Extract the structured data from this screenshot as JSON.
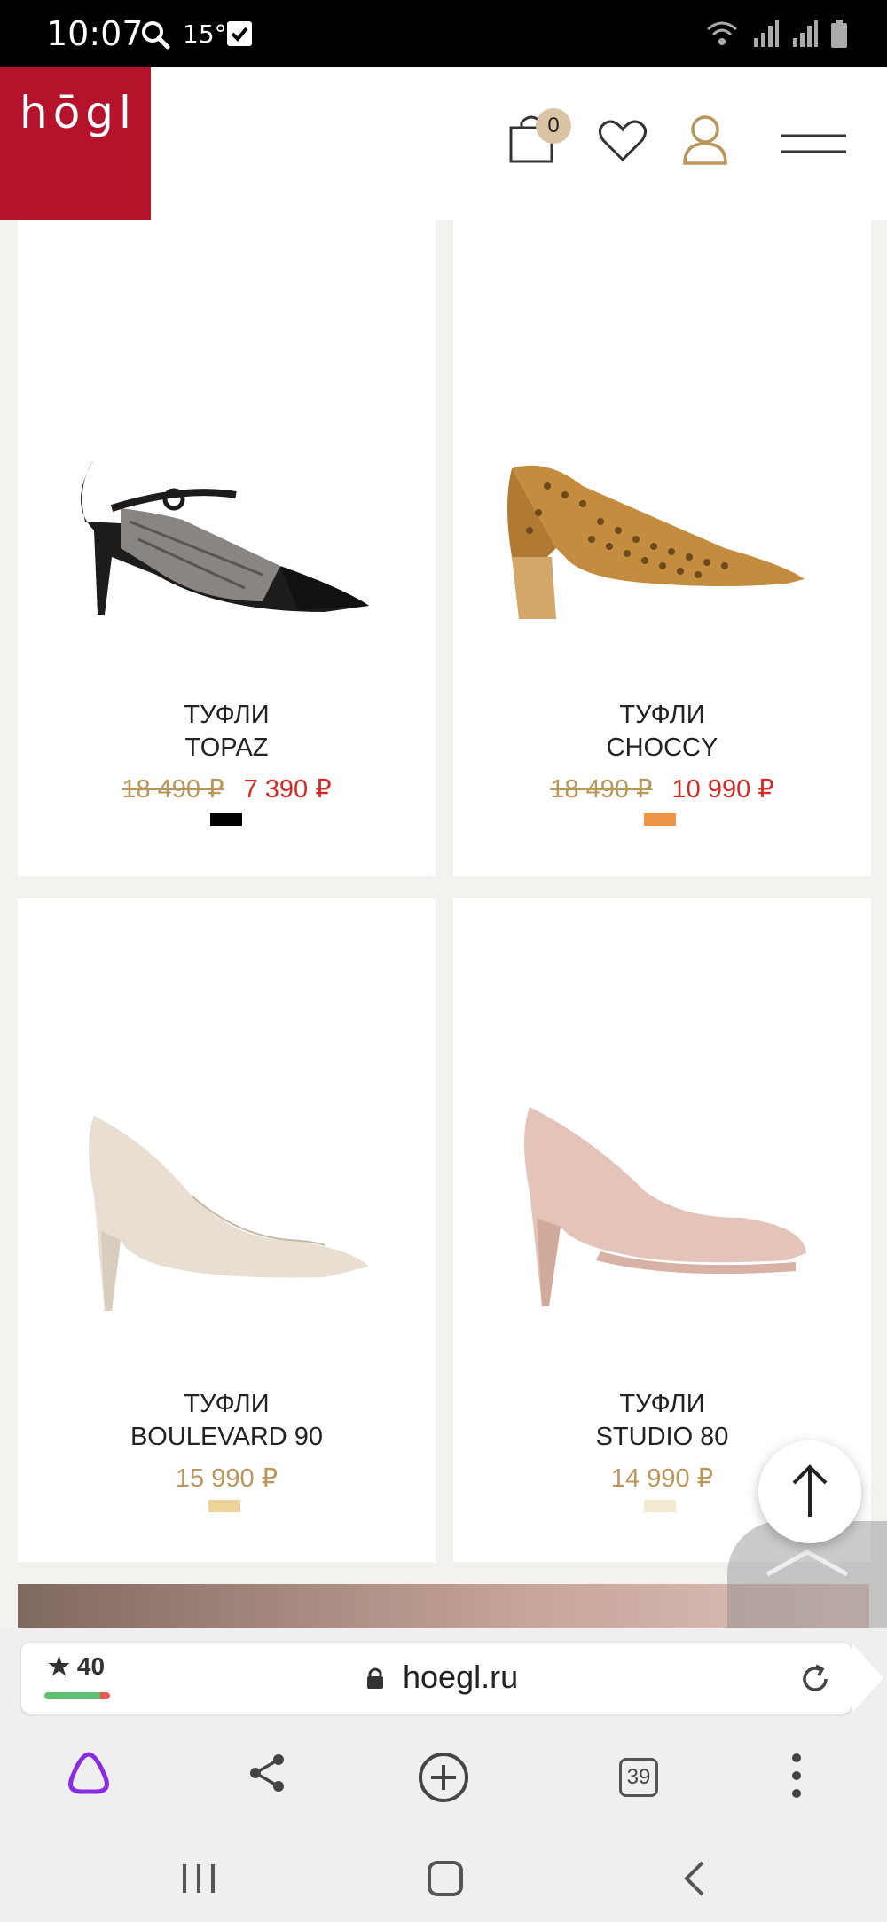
{
  "status_bar": {
    "time": "10:07",
    "temperature": "15°",
    "icons": [
      "search-icon",
      "checkbox-icon",
      "wifi-icon",
      "signal-icon",
      "battery-icon"
    ]
  },
  "header": {
    "logo": "hōgl",
    "cart_count": "0",
    "accent_color": "#b5122b",
    "badge_color": "#d9c4a3"
  },
  "products": [
    {
      "category": "ТУФЛИ",
      "name": "TOPAZ",
      "old_price": "18 490 ₽",
      "price": "7 390 ₽",
      "swatch_color": "#000000",
      "on_sale": true
    },
    {
      "category": "ТУФЛИ",
      "name": "CHOCCY",
      "old_price": "18 490 ₽",
      "price": "10 990 ₽",
      "swatch_color": "#ee9445",
      "on_sale": true
    },
    {
      "category": "ТУФЛИ",
      "name": "BOULEVARD 90",
      "price": "15 990 ₽",
      "swatch_color": "#ecd49b",
      "on_sale": false
    },
    {
      "category": "ТУФЛИ",
      "name": "STUDIO 80",
      "price": "14 990 ₽",
      "swatch_color": "#f3ead2",
      "on_sale": false
    }
  ],
  "browser": {
    "rating": "★ 40",
    "url": "hoegl.ru",
    "tabs_count": "39"
  },
  "colors": {
    "sale_price": "#d52a26",
    "regular_price": "#b9975b",
    "alice": "#8a2be2"
  }
}
